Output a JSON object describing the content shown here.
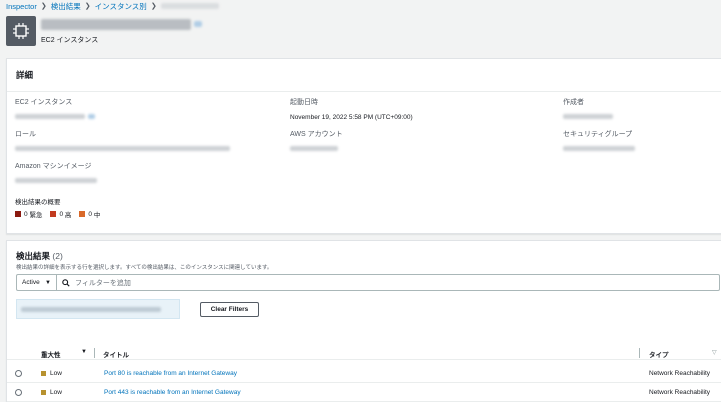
{
  "breadcrumb": {
    "items": [
      "Inspector",
      "検出結果",
      "インスタンス別"
    ]
  },
  "header": {
    "subtitle": "EC2 インスタンス"
  },
  "details": {
    "title": "詳細",
    "fields": {
      "ec2_instance": "EC2 インスタンス",
      "created_at_label": "起動日時",
      "created_at_value": "November 19, 2022 5:58 PM (UTC+09:00)",
      "creator": "作成者",
      "role": "ロール",
      "aws_account": "AWS アカウント",
      "security_group": "セキュリティグループ",
      "ami": "Amazon マシンイメージ"
    },
    "summary_title": "検出結果の概要",
    "summary": [
      {
        "count": "0",
        "label": "緊急",
        "color": "#8b1a10"
      },
      {
        "count": "0",
        "label": "高",
        "color": "#c23a1f"
      },
      {
        "count": "0",
        "label": "中",
        "color": "#d9692a"
      }
    ]
  },
  "findings": {
    "title": "検出結果",
    "count": "(2)",
    "description": "検出結果の詳細を表示する行を選択します。すべての検出結果は、このインスタンスに関連しています。",
    "status_filter": "Active",
    "search_placeholder": "フィルターを追加",
    "clear_filters": "Clear Filters",
    "columns": {
      "severity": "重大性",
      "title": "タイトル",
      "type": "タイプ"
    },
    "rows": [
      {
        "severity": "Low",
        "title": "Port 80 is reachable from an Internet Gateway",
        "type": "Network Reachability"
      },
      {
        "severity": "Low",
        "title": "Port 443 is reachable from an Internet Gateway",
        "type": "Network Reachability"
      }
    ]
  },
  "colors": {
    "link": "#0073bb",
    "low_severity": "#b7922f"
  }
}
